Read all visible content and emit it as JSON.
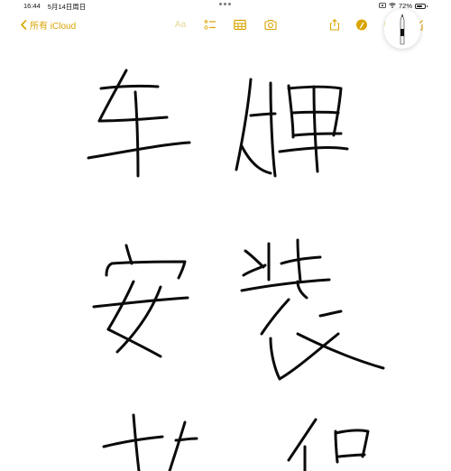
{
  "status_bar": {
    "time": "16:44",
    "date": "5月14日周日",
    "battery": "72%",
    "battery_level": 0.72
  },
  "toolbar": {
    "back_label": "所有 iCloud",
    "format_label": "Aa",
    "accent_color": "#d9a400",
    "icons": [
      "checklist-icon",
      "table-icon",
      "camera-icon",
      "share-icon",
      "markup-icon",
      "more-icon",
      "compose-icon"
    ]
  },
  "note": {
    "handwritten_characters": [
      "车",
      "牌",
      "安",
      "装",
      "教",
      "程"
    ]
  }
}
